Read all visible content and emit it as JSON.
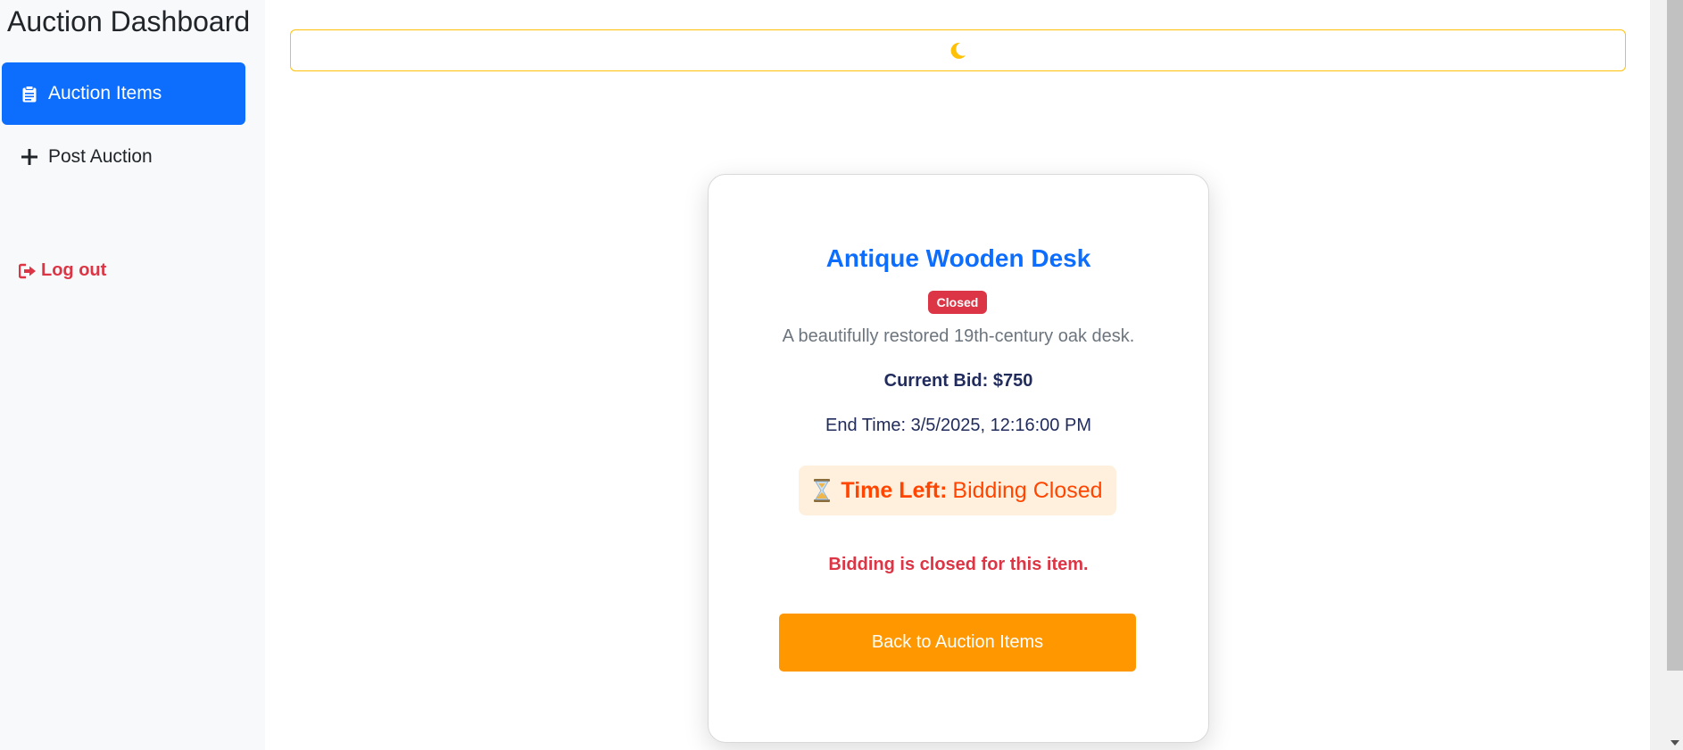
{
  "sidebar": {
    "brand": "Auction Dashboard",
    "items": [
      {
        "label": "Auction Items",
        "icon": "clipboard-icon",
        "active": true
      },
      {
        "label": "Post Auction",
        "icon": "plus-icon",
        "active": false
      }
    ],
    "logout_label": "Log out"
  },
  "topbar": {
    "theme_icon": "moon-icon",
    "accent": "#ffc107"
  },
  "item": {
    "title": "Antique Wooden Desk",
    "status": "Closed",
    "description": "A beautifully restored 19th-century oak desk.",
    "current_bid": "Current Bid: $750",
    "end_time": "End Time: 3/5/2025, 12:16:00 PM",
    "time_left_label": "Time Left:",
    "time_left_value": "Bidding Closed",
    "closed_message": "Bidding is closed for this item.",
    "back_label": "Back to Auction Items"
  },
  "colors": {
    "primary": "#0d6efd",
    "danger": "#dc3545",
    "orange": "#ff9800",
    "time_left": "#ff4500"
  }
}
